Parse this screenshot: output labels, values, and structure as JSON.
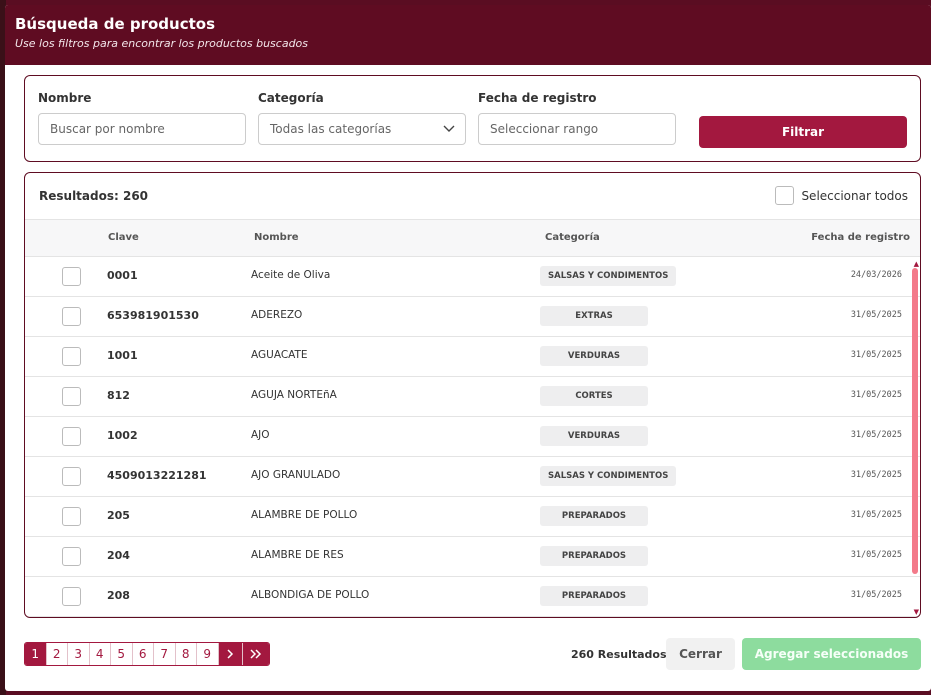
{
  "modal": {
    "title": "Búsqueda de productos",
    "subtitle": "Use los filtros para encontrar los productos buscados"
  },
  "filters": {
    "nombre_label": "Nombre",
    "nombre_placeholder": "Buscar por nombre",
    "categoria_label": "Categoría",
    "categoria_value": "Todas las categorías",
    "fecha_label": "Fecha de registro",
    "fecha_placeholder": "Seleccionar rango",
    "filter_button": "Filtrar"
  },
  "results": {
    "count_label": "Resultados: 260",
    "select_all_label": "Seleccionar todos",
    "columns": [
      "Clave",
      "Nombre",
      "Categoría",
      "Fecha de registro"
    ],
    "rows": [
      {
        "clave": "0001",
        "nombre": "Aceite de Oliva",
        "categoria": "SALSAS Y CONDIMENTOS",
        "fecha": "24/03/2026"
      },
      {
        "clave": "653981901530",
        "nombre": "ADEREZO",
        "categoria": "EXTRAS",
        "fecha": "31/05/2025"
      },
      {
        "clave": "1001",
        "nombre": "AGUACATE",
        "categoria": "VERDURAS",
        "fecha": "31/05/2025"
      },
      {
        "clave": "812",
        "nombre": "AGUJA NORTEñA",
        "categoria": "CORTES",
        "fecha": "31/05/2025"
      },
      {
        "clave": "1002",
        "nombre": "AJO",
        "categoria": "VERDURAS",
        "fecha": "31/05/2025"
      },
      {
        "clave": "4509013221281",
        "nombre": "AJO GRANULADO",
        "categoria": "SALSAS Y CONDIMENTOS",
        "fecha": "31/05/2025"
      },
      {
        "clave": "205",
        "nombre": "ALAMBRE DE POLLO",
        "categoria": "PREPARADOS",
        "fecha": "31/05/2025"
      },
      {
        "clave": "204",
        "nombre": "ALAMBRE DE RES",
        "categoria": "PREPARADOS",
        "fecha": "31/05/2025"
      },
      {
        "clave": "208",
        "nombre": "ALBONDIGA DE POLLO",
        "categoria": "PREPARADOS",
        "fecha": "31/05/2025"
      }
    ]
  },
  "pagination": {
    "pages": [
      "1",
      "2",
      "3",
      "4",
      "5",
      "6",
      "7",
      "8",
      "9"
    ],
    "active_page": "1",
    "next_icon": "chevron-right-icon",
    "last_icon": "double-chevron-right-icon"
  },
  "footer": {
    "count_text": "260 Resultados",
    "close_button": "Cerrar",
    "add_button": "Agregar seleccionados"
  },
  "colors": {
    "header_bg": "#5f0c22",
    "accent": "#a3183f",
    "add_button_bg": "#8ddc9e",
    "scroll_thumb": "#f37a8a"
  }
}
